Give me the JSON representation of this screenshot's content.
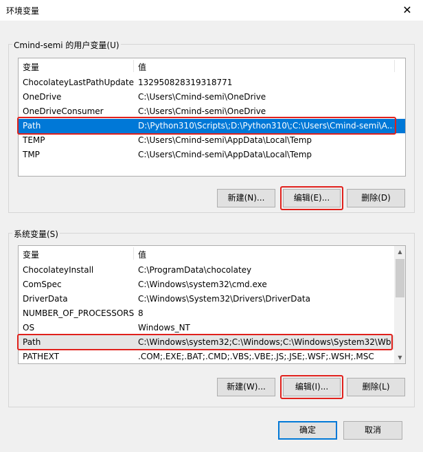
{
  "window": {
    "title": "环境变量",
    "close_glyph": "✕"
  },
  "user_vars": {
    "label": "Cmind-semi 的用户变量(U)",
    "col_name": "变量",
    "col_value": "值",
    "rows": [
      {
        "name": "ChocolateyLastPathUpdate",
        "value": "132950828319318771"
      },
      {
        "name": "OneDrive",
        "value": "C:\\Users\\Cmind-semi\\OneDrive"
      },
      {
        "name": "OneDriveConsumer",
        "value": "C:\\Users\\Cmind-semi\\OneDrive"
      },
      {
        "name": "Path",
        "value": "D:\\Python310\\Scripts\\;D:\\Python310\\;C:\\Users\\Cmind-semi\\A..."
      },
      {
        "name": "TEMP",
        "value": "C:\\Users\\Cmind-semi\\AppData\\Local\\Temp"
      },
      {
        "name": "TMP",
        "value": "C:\\Users\\Cmind-semi\\AppData\\Local\\Temp"
      }
    ],
    "btn_new": "新建(N)...",
    "btn_edit": "编辑(E)...",
    "btn_delete": "删除(D)"
  },
  "system_vars": {
    "label": "系统变量(S)",
    "col_name": "变量",
    "col_value": "值",
    "rows": [
      {
        "name": "ChocolateyInstall",
        "value": "C:\\ProgramData\\chocolatey"
      },
      {
        "name": "ComSpec",
        "value": "C:\\Windows\\system32\\cmd.exe"
      },
      {
        "name": "DriverData",
        "value": "C:\\Windows\\System32\\Drivers\\DriverData"
      },
      {
        "name": "NUMBER_OF_PROCESSORS",
        "value": "8"
      },
      {
        "name": "OS",
        "value": "Windows_NT"
      },
      {
        "name": "Path",
        "value": "C:\\Windows\\system32;C:\\Windows;C:\\Windows\\System32\\Wb..."
      },
      {
        "name": "PATHEXT",
        "value": ".COM;.EXE;.BAT;.CMD;.VBS;.VBE;.JS;.JSE;.WSF;.WSH;.MSC"
      }
    ],
    "btn_new": "新建(W)...",
    "btn_edit": "编辑(I)...",
    "btn_delete": "删除(L)"
  },
  "footer": {
    "ok": "确定",
    "cancel": "取消"
  },
  "colors": {
    "selection": "#0078d7",
    "highlight_box": "#e0201b"
  }
}
